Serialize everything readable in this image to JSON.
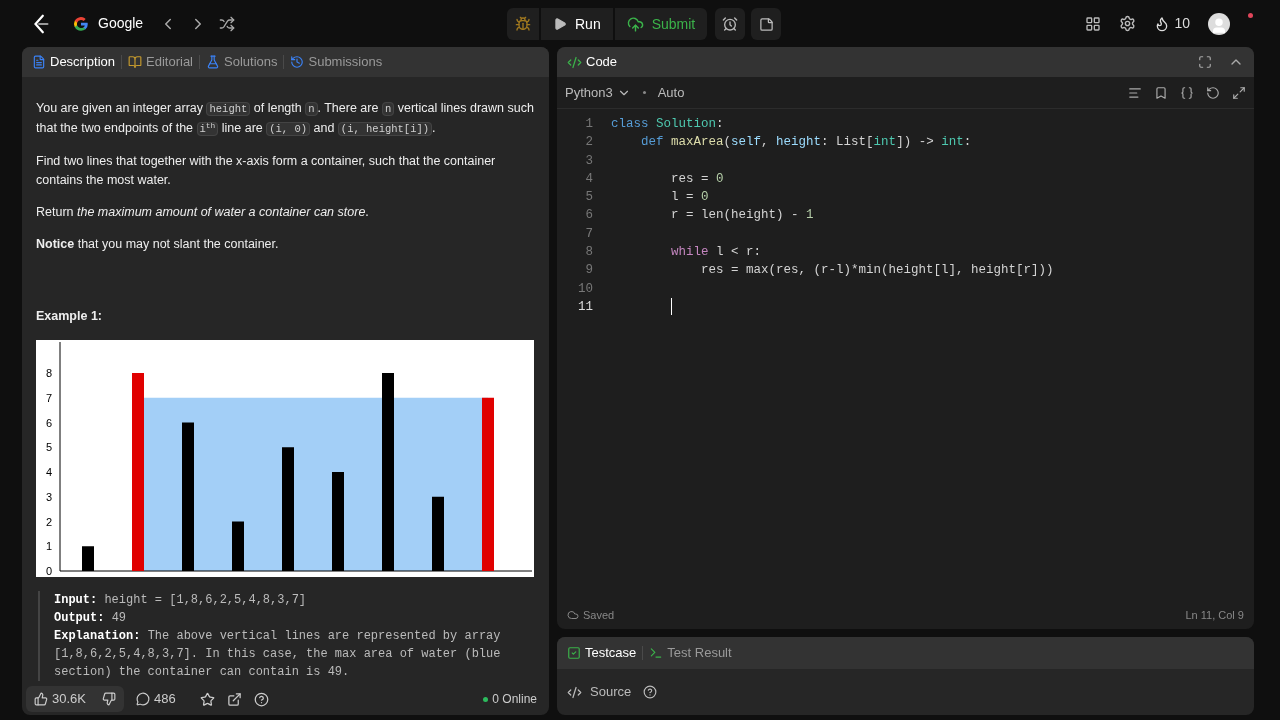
{
  "topbar": {
    "list_name": "Google",
    "run": "Run",
    "submit": "Submit",
    "streak": "10"
  },
  "description": {
    "tabs": [
      {
        "label": "Description",
        "selected": true
      },
      {
        "label": "Editorial",
        "selected": false
      },
      {
        "label": "Solutions",
        "selected": false
      },
      {
        "label": "Submissions",
        "selected": false
      }
    ],
    "paragraphs": [
      [
        {
          "kind": "text",
          "text": "You are given an integer array "
        },
        {
          "kind": "code",
          "text": "height"
        },
        {
          "kind": "text",
          "text": " of length "
        },
        {
          "kind": "code",
          "text": "n"
        },
        {
          "kind": "text",
          "text": ". There are "
        },
        {
          "kind": "code",
          "text": "n"
        },
        {
          "kind": "text",
          "text": " vertical lines drawn such that the two endpoints of the "
        },
        {
          "kind": "code",
          "text": "i$^{th}$"
        },
        {
          "kind": "text",
          "text": " line are "
        },
        {
          "kind": "code",
          "text": "(i, 0)"
        },
        {
          "kind": "text",
          "text": " and "
        },
        {
          "kind": "code",
          "text": "(i, height[i])"
        },
        {
          "kind": "text",
          "text": "."
        }
      ],
      [
        {
          "kind": "text",
          "text": "Find two lines that together with the x-axis form a container, such that the container contains the most water."
        }
      ],
      [
        {
          "kind": "text",
          "text": "Return "
        },
        {
          "kind": "text",
          "text": "*the maximum amount of water a container can store*"
        },
        {
          "kind": "text",
          "text": "."
        }
      ],
      [
        {
          "kind": "text",
          "text": "**Notice** that you may not slant the container."
        }
      ]
    ],
    "example_title": "Example 1:",
    "chart_data": {
      "type": "bar",
      "yticks": [
        0,
        1,
        2,
        3,
        4,
        5,
        6,
        7,
        8
      ],
      "ylim": [
        0,
        8
      ],
      "series": [
        {
          "color": "#000000",
          "values": [
            1,
            null,
            6,
            2,
            5,
            4,
            8,
            3,
            null
          ]
        },
        {
          "color": "#e00000",
          "values": [
            null,
            8,
            null,
            null,
            null,
            null,
            null,
            null,
            7
          ]
        }
      ]
    },
    "example": [
      {
        "label": "Input:",
        "value": "height = [1,8,6,2,5,4,8,3,7]"
      },
      {
        "label": "Output:",
        "value": "49"
      },
      {
        "label": "Explanation:",
        "value": "The above vertical lines are represented by array [1,8,6,2,5,4,8,3,7]. In this case, the max area of water (blue section) the container can contain is 49."
      }
    ],
    "footer": {
      "likes": "30.6K",
      "comments": "486",
      "online": "0 Online"
    }
  },
  "editor": {
    "title": "Code",
    "language": "Python3",
    "mode": "Auto",
    "status": "Saved",
    "cursor": "Ln 11, Col 9",
    "lines": [
      {
        "number": "1",
        "active": false,
        "tokens": [
          {
            "kind": "keyword",
            "text": "class "
          },
          {
            "kind": "type",
            "text": "Solution"
          },
          {
            "kind": "plain",
            "text": ":"
          }
        ]
      },
      {
        "number": "2",
        "active": false,
        "tokens": [
          {
            "kind": "keyword",
            "text": "    def "
          },
          {
            "kind": "function",
            "text": "maxArea"
          },
          {
            "kind": "plain",
            "text": "("
          },
          {
            "kind": "variable",
            "text": "self"
          },
          {
            "kind": "plain",
            "text": ", "
          },
          {
            "kind": "variable",
            "text": "height"
          },
          {
            "kind": "plain",
            "text": ": List["
          },
          {
            "kind": "type",
            "text": "int"
          },
          {
            "kind": "plain",
            "text": "]) -> "
          },
          {
            "kind": "type",
            "text": "int"
          },
          {
            "kind": "plain",
            "text": ":"
          }
        ]
      },
      {
        "number": "3",
        "active": false
      },
      {
        "number": "4",
        "active": false,
        "tokens": [
          {
            "kind": "plain",
            "text": "        res = "
          },
          {
            "kind": "number",
            "text": "0"
          }
        ]
      },
      {
        "number": "5",
        "active": false,
        "tokens": [
          {
            "kind": "plain",
            "text": "        l = "
          },
          {
            "kind": "number",
            "text": "0"
          }
        ]
      },
      {
        "number": "6",
        "active": false,
        "tokens": [
          {
            "kind": "plain",
            "text": "        r = len(height) - "
          },
          {
            "kind": "number",
            "text": "1"
          }
        ]
      },
      {
        "number": "7",
        "active": false
      },
      {
        "number": "8",
        "active": false,
        "tokens": [
          {
            "kind": "control",
            "text": "        while"
          },
          {
            "kind": "plain",
            "text": " l < r:"
          }
        ]
      },
      {
        "number": "9",
        "active": false,
        "tokens": [
          {
            "kind": "plain",
            "text": "            res = max(res, (r-l)*min(height[l], height[r]))"
          }
        ]
      },
      {
        "number": "10",
        "active": false
      },
      {
        "number": "11",
        "active": true
      }
    ]
  },
  "testcase": {
    "tabs": [
      {
        "label": "Testcase",
        "selected": true
      },
      {
        "label": "Test Result",
        "selected": false
      }
    ],
    "source": "Source"
  }
}
